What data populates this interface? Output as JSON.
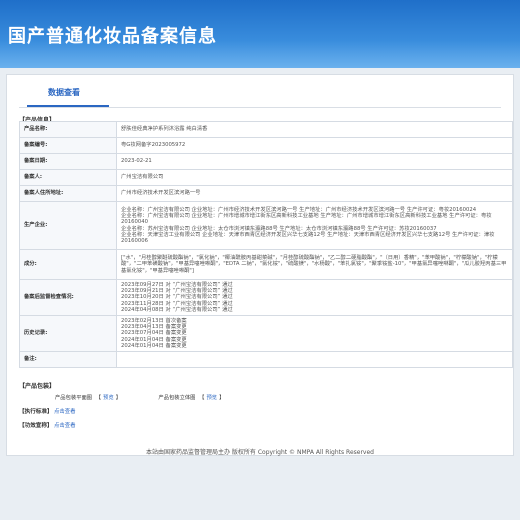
{
  "banner": {
    "title": "国产普通化妆品备案信息"
  },
  "tabs": {
    "active": "数据查看"
  },
  "section_info": "【产品信息】",
  "info": {
    "product_name": {
      "label": "产品名称:",
      "value": "舒肤佳经典净护系列沐浴露 纯白清香"
    },
    "record_no": {
      "label": "备案编号:",
      "value": "粤G妆网备字2023005972"
    },
    "record_date": {
      "label": "备案日期:",
      "value": "2023-02-21"
    },
    "registrant": {
      "label": "备案人:",
      "value": "广州宝洁有限公司"
    },
    "address": {
      "label": "备案人住所地址:",
      "value": "广州市经济技术开发区滨河路一号"
    },
    "manufacturer": {
      "label": "生产企业:",
      "lines": [
        "企业名称：广州宝洁有限公司 企业地址：广州市经济技术开发区滨河路一号 生产地址：广州市经济技术开发区滨河路一号 生产许可证：粤妆20160024",
        "企业名称：广州宝洁有限公司 企业地址：广州市增城市增江街东区高新科技工业基地 生产地址：广州市增城市增江街东区高新科技工业基地 生产许可证：粤妆20160040",
        "企业名称：苏州宝洁有限公司 企业地址：太仓市浏河镇东瀛路88号 生产地址：太仓市浏河镇东瀛路88号 生产许可证：苏妆20160037",
        "企业名称：天津宝洁工业有限公司 企业地址：天津市西青区经济开发区兴华七支路12号 生产地址：天津市西青区经济开发区兴华七支路12号 生产许可证：津妆20160006"
      ]
    },
    "ingredients": {
      "label": "成分:",
      "value": "[\"水\"，\"月桂醇聚醚硫酸酯钠\"，\"氯化钠\"，\"椰油酰胺丙基甜菜碱\"，\"月桂醇硫酸酯钠\"，\"乙二醇二硬脂酸酯\"，\"（日用）香精\"，\"苯甲酸钠\"，\"柠檬酸钠\"，\"柠檬酸\"，\"二甲苯磺酸钠\"，\"甲基异噻唑啉酮\"，\"EDTA 二钠\"，\"氯化铵\"，\"硫酸镁\"，\"水杨酸\"，\"苯扎氯铵\"，\"聚季铵盐-10\"，\"甲基氯异噻唑啉酮\"，\"瓜儿胶羟丙基三甲基氯化铵\"，\"甲基异噻唑啉酮\"]"
    },
    "supervision": {
      "label": "备案后监督检查情况:",
      "lines": [
        "2023年09月27日 对 “广州宝洁有限公司” 通过",
        "2023年09月21日 对 “广州宝洁有限公司” 通过",
        "2023年10月20日 对 “广州宝洁有限公司” 通过",
        "2023年11月28日 对 “广州宝洁有限公司” 通过",
        "2024年04月08日 对 “广州宝洁有限公司” 通过"
      ]
    },
    "history": {
      "label": "历史记录:",
      "lines": [
        "2023年02月13日 首次备案",
        "2023年04月13日 备案变更",
        "2023年07月04日 备案变更",
        "2024年01月04日 备案变更",
        "2024年01月04日 备案变更"
      ]
    },
    "remark": {
      "label": "备注:",
      "value": ""
    }
  },
  "section_package": "【产品包装】",
  "package": {
    "flat_label": "产品包装平面图",
    "flat_link": "预览",
    "solid_label": "产品包装立体图",
    "solid_link": "预览"
  },
  "section_exec": "【执行标准】",
  "exec_link": "点击查看",
  "section_safety": "【功效宣称】",
  "safety_link": "点击查看",
  "footer": "本站由国家药品监督管理局主办 版权所有 Copyright © NMPA All Rights Reserved"
}
